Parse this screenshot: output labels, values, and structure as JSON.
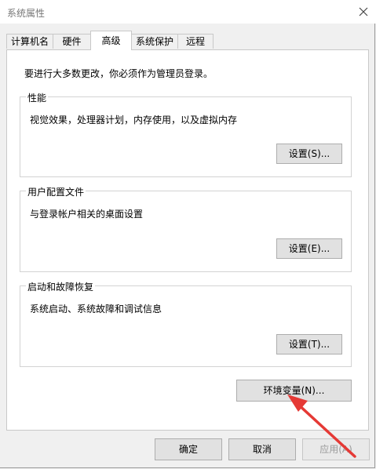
{
  "window": {
    "title": "系统属性",
    "close_icon": "close-icon"
  },
  "tabs": [
    {
      "label": "计算机名"
    },
    {
      "label": "硬件"
    },
    {
      "label": "高级",
      "active": true
    },
    {
      "label": "系统保护"
    },
    {
      "label": "远程"
    }
  ],
  "panel": {
    "intro": "要进行大多数更改，你必须作为管理员登录。",
    "performance": {
      "title": "性能",
      "desc": "视觉效果，处理器计划，内存使用，以及虚拟内存",
      "button": "设置(S)..."
    },
    "profiles": {
      "title": "用户配置文件",
      "desc": "与登录帐户相关的桌面设置",
      "button": "设置(E)..."
    },
    "startup": {
      "title": "启动和故障恢复",
      "desc": "系统启动、系统故障和调试信息",
      "button": "设置(T)..."
    },
    "env_button": "环境变量(N)..."
  },
  "footer": {
    "ok": "确定",
    "cancel": "取消",
    "apply": "应用(A)"
  },
  "colors": {
    "annotation_arrow": "#e53935"
  }
}
